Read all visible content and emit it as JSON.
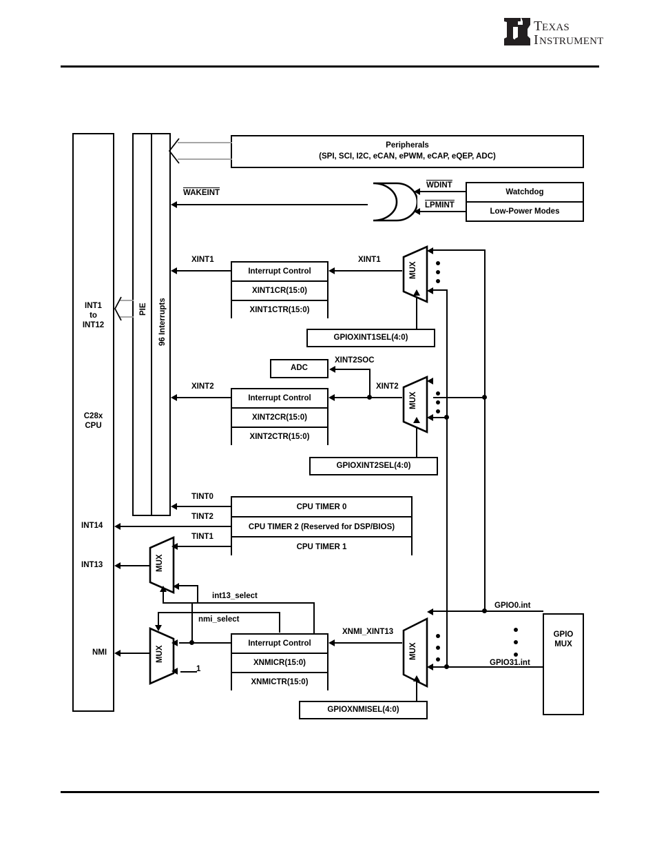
{
  "header": {
    "logo_line1": "TEXAS",
    "logo_line2": "INSTRUMENTS",
    "logo_name": "texas-instruments-logo"
  },
  "diagram": {
    "cpu": {
      "int_range_line1": "INT1",
      "int_range_line2": "to",
      "int_range_line3": "INT12",
      "name_line1": "C28x",
      "name_line2": "CPU",
      "int14": "INT14",
      "int13": "INT13",
      "nmi": "NMI"
    },
    "pie": {
      "label": "PIE",
      "interrupts": "96 Interrupts"
    },
    "peripherals": {
      "title": "Peripherals",
      "list": "(SPI, SCI, I2C, eCAN, ePWM, eCAP, eQEP, ADC)"
    },
    "wake": {
      "wakeint": "WAKEINT",
      "wdint": "WDINT",
      "lpmint": "LPMINT",
      "watchdog": "Watchdog",
      "lowpower": "Low-Power Modes"
    },
    "xint1": {
      "out_label": "XINT1",
      "in_label": "XINT1",
      "ctrl": "Interrupt Control",
      "reg_cr": "XINT1CR(15:0)",
      "reg_ctr": "XINT1CTR(15:0)",
      "sel": "GPIOXINT1SEL(4:0)",
      "mux": "MUX"
    },
    "xint2": {
      "out_label": "XINT2",
      "in_label": "XINT2",
      "soc_label": "XINT2SOC",
      "adc": "ADC",
      "ctrl": "Interrupt Control",
      "reg_cr": "XINT2CR(15:0)",
      "reg_ctr": "XINT2CTR(15:0)",
      "sel": "GPIOXINT2SEL(4:0)",
      "mux": "MUX"
    },
    "timers": {
      "tint0": "TINT0",
      "tint1": "TINT1",
      "tint2": "TINT2",
      "timer0": "CPU TIMER 0",
      "timer2": "CPU TIMER 2 (Reserved for DSP/BIOS)",
      "timer1": "CPU TIMER 1",
      "mux": "MUX",
      "int13_select": "int13_select"
    },
    "nmi": {
      "nmi_select": "nmi_select",
      "one": "1",
      "ctrl": "Interrupt Control",
      "reg_cr": "XNMICR(15:0)",
      "reg_ctr": "XNMICTR(15:0)",
      "xnmi_xint13": "XNMI_XINT13",
      "sel": "GPIOXNMISEL(4:0)",
      "mux_left": "MUX",
      "mux_right": "MUX"
    },
    "gpio": {
      "gpio0": "GPIO0.int",
      "gpio31": "GPIO31.int",
      "box_line1": "GPIO",
      "box_line2": "MUX"
    }
  }
}
